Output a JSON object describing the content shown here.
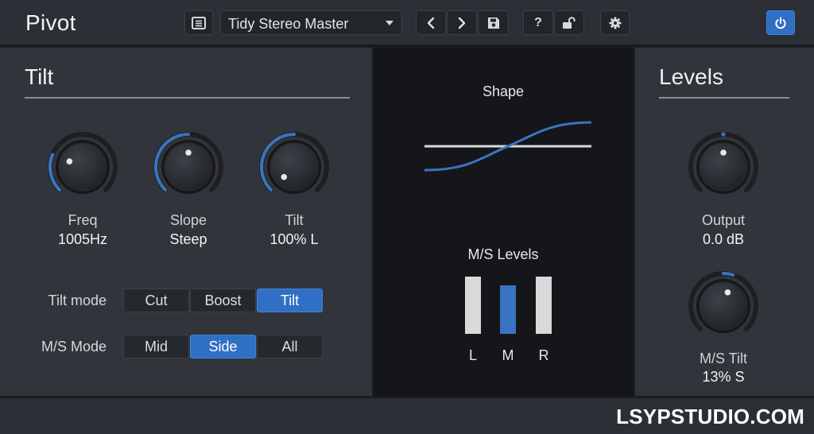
{
  "app": {
    "title": "Pivot"
  },
  "toolbar": {
    "preset_name": "Tidy Stereo Master",
    "help_label": "?",
    "icons": {
      "browser": "list-icon",
      "previous": "chevron-left-icon",
      "next": "chevron-right-icon",
      "save": "floppy-disk-icon",
      "lock": "unlock-icon",
      "settings": "gear-icon",
      "power": "power-icon"
    }
  },
  "tilt_section": {
    "title": "Tilt",
    "knobs": [
      {
        "label": "Freq",
        "value": "1005Hz",
        "level": 0.25
      },
      {
        "label": "Slope",
        "value": "Steep",
        "level": 0.5
      },
      {
        "label": "Tilt",
        "value": "100% L",
        "level": 0.0,
        "bipolar": true
      }
    ],
    "tilt_mode": {
      "label": "Tilt mode",
      "options": [
        "Cut",
        "Boost",
        "Tilt"
      ],
      "selected": "Tilt"
    },
    "ms_mode": {
      "label": "M/S Mode",
      "options": [
        "Mid",
        "Side",
        "All"
      ],
      "selected": "Side"
    }
  },
  "center": {
    "shape_label": "Shape",
    "ms_levels_label": "M/S Levels",
    "meters": [
      {
        "letter": "L",
        "level": 1.0,
        "color": "#d9d9d9"
      },
      {
        "letter": "M",
        "level": 0.85,
        "color": "#3a74c0"
      },
      {
        "letter": "R",
        "level": 1.0,
        "color": "#d9d9d9"
      }
    ]
  },
  "levels_section": {
    "title": "Levels",
    "knobs": [
      {
        "label": "Output",
        "value": "0.0 dB",
        "level": 0.5,
        "bipolar": true
      },
      {
        "label": "M/S Tilt",
        "value": "13% S",
        "level": 0.565,
        "bipolar": true
      }
    ]
  },
  "colors": {
    "accent": "#2f6fc4",
    "knob_arc": "#3a74c0",
    "background": "#31343a"
  },
  "footer": {
    "watermark": "LSYPSTUDIO.COM"
  }
}
